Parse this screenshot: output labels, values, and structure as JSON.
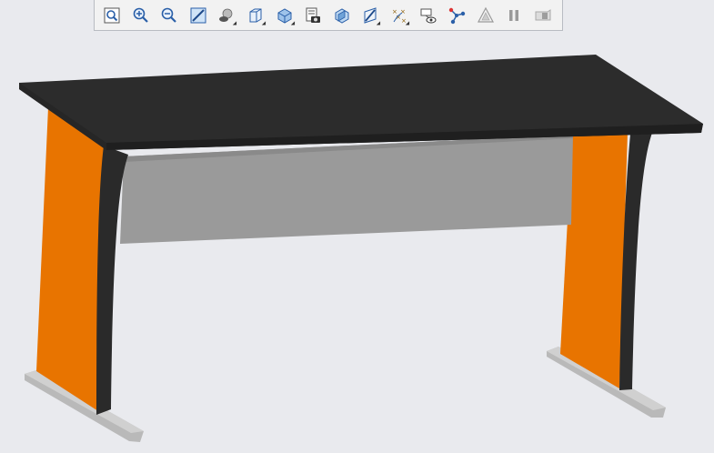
{
  "toolbar": {
    "icons": [
      {
        "name": "refit-icon",
        "has_menu": false
      },
      {
        "name": "zoom-in-icon",
        "has_menu": false
      },
      {
        "name": "zoom-out-icon",
        "has_menu": false
      },
      {
        "name": "repaint-icon",
        "has_menu": false
      },
      {
        "name": "perspective-icon",
        "has_menu": true
      },
      {
        "name": "display-style-icon",
        "has_menu": true
      },
      {
        "name": "saved-orientations-icon",
        "has_menu": true
      },
      {
        "name": "view-manager-icon",
        "has_menu": false
      },
      {
        "name": "section-icon",
        "has_menu": false
      },
      {
        "name": "datum-display-icon",
        "has_menu": true
      },
      {
        "name": "annotation-display-icon",
        "has_menu": true
      },
      {
        "name": "spin-center-icon",
        "has_menu": false
      },
      {
        "name": "network-icon",
        "has_menu": false
      },
      {
        "name": "render-icon",
        "has_menu": false
      },
      {
        "name": "pause-icon",
        "has_menu": false
      },
      {
        "name": "appearance-icon",
        "has_menu": false
      }
    ]
  },
  "colors": {
    "background": "#e9eaee",
    "tabletop": "#2b2b2b",
    "leg_panel": "#e87400",
    "modesty_panel": "#999999",
    "frame": "#2a2a2a",
    "foot": "#b8b8b8"
  }
}
